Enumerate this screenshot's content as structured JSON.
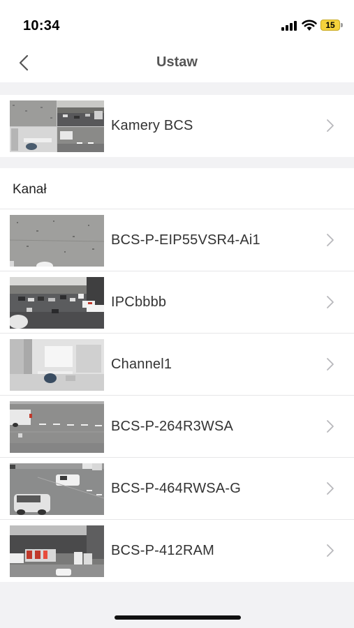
{
  "status_bar": {
    "time": "10:34",
    "battery_level": "15",
    "icons": [
      "signal-icon",
      "wifi-icon",
      "battery-icon"
    ]
  },
  "nav": {
    "title": "Ustaw",
    "back_icon": "chevron-left-icon"
  },
  "devices_group": {
    "items": [
      {
        "label": "Kamery BCS",
        "thumbnail": "multi-camera-grid"
      }
    ]
  },
  "channels": {
    "title": "Kanał",
    "items": [
      {
        "label": "BCS-P-EIP55VSR4-Ai1",
        "thumbnail": "ceiling-view"
      },
      {
        "label": "IPCbbbb",
        "thumbnail": "parking-lot-view"
      },
      {
        "label": "Channel1",
        "thumbnail": "indoor-room-view"
      },
      {
        "label": "BCS-P-264R3WSA",
        "thumbnail": "road-view"
      },
      {
        "label": "BCS-P-464RWSA-G",
        "thumbnail": "parking-cars-view"
      },
      {
        "label": "BCS-P-412RAM",
        "thumbnail": "warehouse-trucks-view"
      }
    ]
  },
  "colors": {
    "background": "#f2f2f4",
    "battery": "#f5d23c",
    "chevron": "#b8b8bc"
  }
}
